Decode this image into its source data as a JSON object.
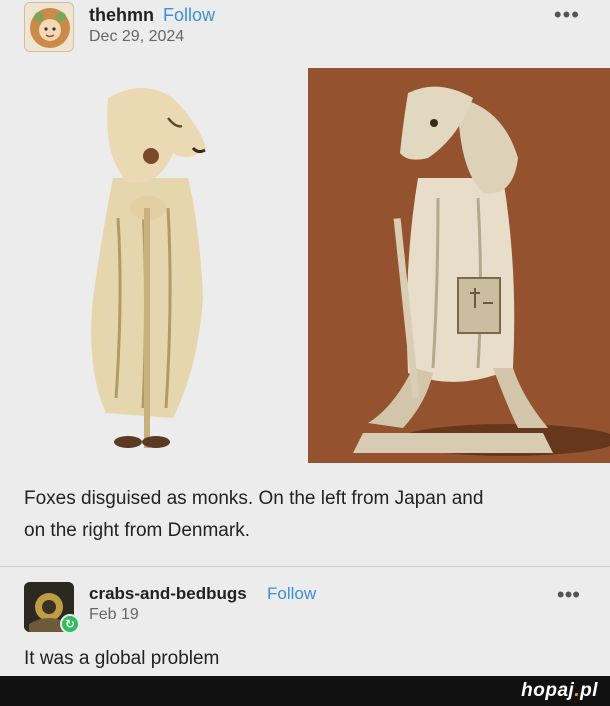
{
  "post": {
    "username": "thehmn",
    "follow_label": "Follow",
    "date": "Dec 29, 2024",
    "more_label": "•••",
    "caption_line1": "Foxes disguised as monks. On the left from Japan and",
    "caption_line2": "on the right from Denmark."
  },
  "reblog": {
    "username": "crabs-and-bedbugs",
    "follow_label": "Follow",
    "date": "Feb 19",
    "more_label": "•••",
    "text": "It was a global problem",
    "badge_icon": "reblog-icon"
  },
  "footer": {
    "watermark_main": "hopaj",
    "watermark_dot": ".",
    "watermark_tld": "pl"
  },
  "colors": {
    "accent": "#3b8fd9",
    "background": "#ececec",
    "reblog_badge": "#2fbf5a",
    "right_photo_bg": "#8f4f2c"
  }
}
